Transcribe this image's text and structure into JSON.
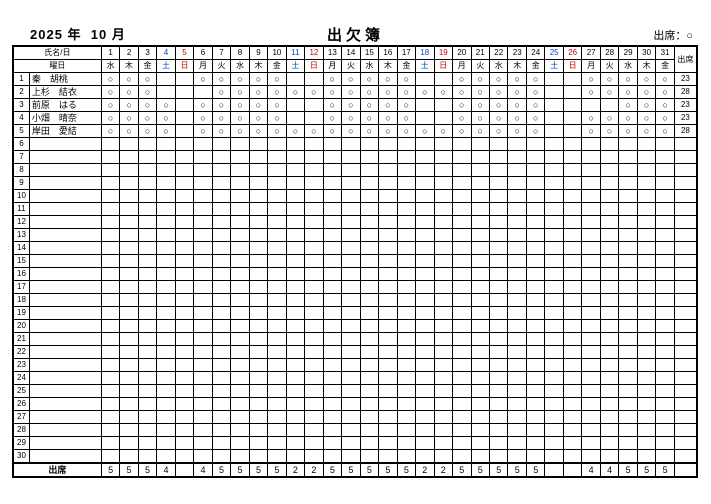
{
  "year_label": "2025 年",
  "month_label": "10 月",
  "title": "出欠簿",
  "legend": "出席：○",
  "name_day_header": "氏名/日",
  "weekday_header": "曜日",
  "total_header": "出席",
  "footer_label": "出席",
  "days": [
    1,
    2,
    3,
    4,
    5,
    6,
    7,
    8,
    9,
    10,
    11,
    12,
    13,
    14,
    15,
    16,
    17,
    18,
    19,
    20,
    21,
    22,
    23,
    24,
    25,
    26,
    27,
    28,
    29,
    30,
    31
  ],
  "weekdays": [
    "水",
    "木",
    "金",
    "土",
    "日",
    "月",
    "火",
    "水",
    "木",
    "金",
    "土",
    "日",
    "月",
    "火",
    "水",
    "木",
    "金",
    "土",
    "日",
    "月",
    "火",
    "水",
    "木",
    "金",
    "土",
    "日",
    "月",
    "火",
    "水",
    "木",
    "金"
  ],
  "day_color": [
    "",
    "",
    "",
    "sat",
    "sun",
    "",
    "",
    "",
    "",
    "",
    "sat",
    "sun",
    "",
    "",
    "",
    "",
    "",
    "sat",
    "sun",
    "",
    "",
    "",
    "",
    "",
    "sat",
    "sun",
    "",
    "",
    "",
    "",
    ""
  ],
  "row_count": 30,
  "students": [
    {
      "n": 1,
      "name": "秦　胡桃",
      "marks": [
        "○",
        "○",
        "○",
        "",
        "",
        "○",
        "○",
        "○",
        "○",
        "○",
        "",
        "",
        "○",
        "○",
        "○",
        "○",
        "○",
        "",
        "",
        "○",
        "○",
        "○",
        "○",
        "○",
        "",
        "",
        "○",
        "○",
        "○",
        "○",
        "○"
      ],
      "total": 23
    },
    {
      "n": 2,
      "name": "上杉　結衣",
      "marks": [
        "○",
        "○",
        "○",
        "",
        "",
        "",
        "○",
        "○",
        "○",
        "○",
        "○",
        "○",
        "○",
        "○",
        "○",
        "○",
        "○",
        "○",
        "○",
        "○",
        "○",
        "○",
        "○",
        "○",
        "",
        "",
        "○",
        "○",
        "○",
        "○",
        "○"
      ],
      "total": 28
    },
    {
      "n": 3,
      "name": "前原　はる",
      "marks": [
        "○",
        "○",
        "○",
        "○",
        "",
        "○",
        "○",
        "○",
        "○",
        "○",
        "",
        "",
        "○",
        "○",
        "○",
        "○",
        "○",
        "",
        "",
        "○",
        "○",
        "○",
        "○",
        "○",
        "",
        "",
        "",
        "",
        "○",
        "○",
        "○"
      ],
      "total": 23
    },
    {
      "n": 4,
      "name": "小畑　晴奈",
      "marks": [
        "○",
        "○",
        "○",
        "○",
        "",
        "○",
        "○",
        "○",
        "○",
        "○",
        "",
        "",
        "○",
        "○",
        "○",
        "○",
        "○",
        "",
        "",
        "○",
        "○",
        "○",
        "○",
        "○",
        "",
        "",
        "○",
        "○",
        "○",
        "○",
        "○"
      ],
      "total": 23
    },
    {
      "n": 5,
      "name": "岸田　愛結",
      "marks": [
        "○",
        "○",
        "○",
        "○",
        "",
        "○",
        "○",
        "○",
        "○",
        "○",
        "○",
        "○",
        "○",
        "○",
        "○",
        "○",
        "○",
        "○",
        "○",
        "○",
        "○",
        "○",
        "○",
        "○",
        "",
        "",
        "○",
        "○",
        "○",
        "○",
        "○"
      ],
      "total": 28
    }
  ],
  "footer_totals": [
    5,
    5,
    5,
    4,
    "",
    4,
    5,
    5,
    5,
    5,
    2,
    2,
    5,
    5,
    5,
    5,
    5,
    2,
    2,
    5,
    5,
    5,
    5,
    5,
    "",
    "",
    4,
    4,
    5,
    5,
    5
  ]
}
